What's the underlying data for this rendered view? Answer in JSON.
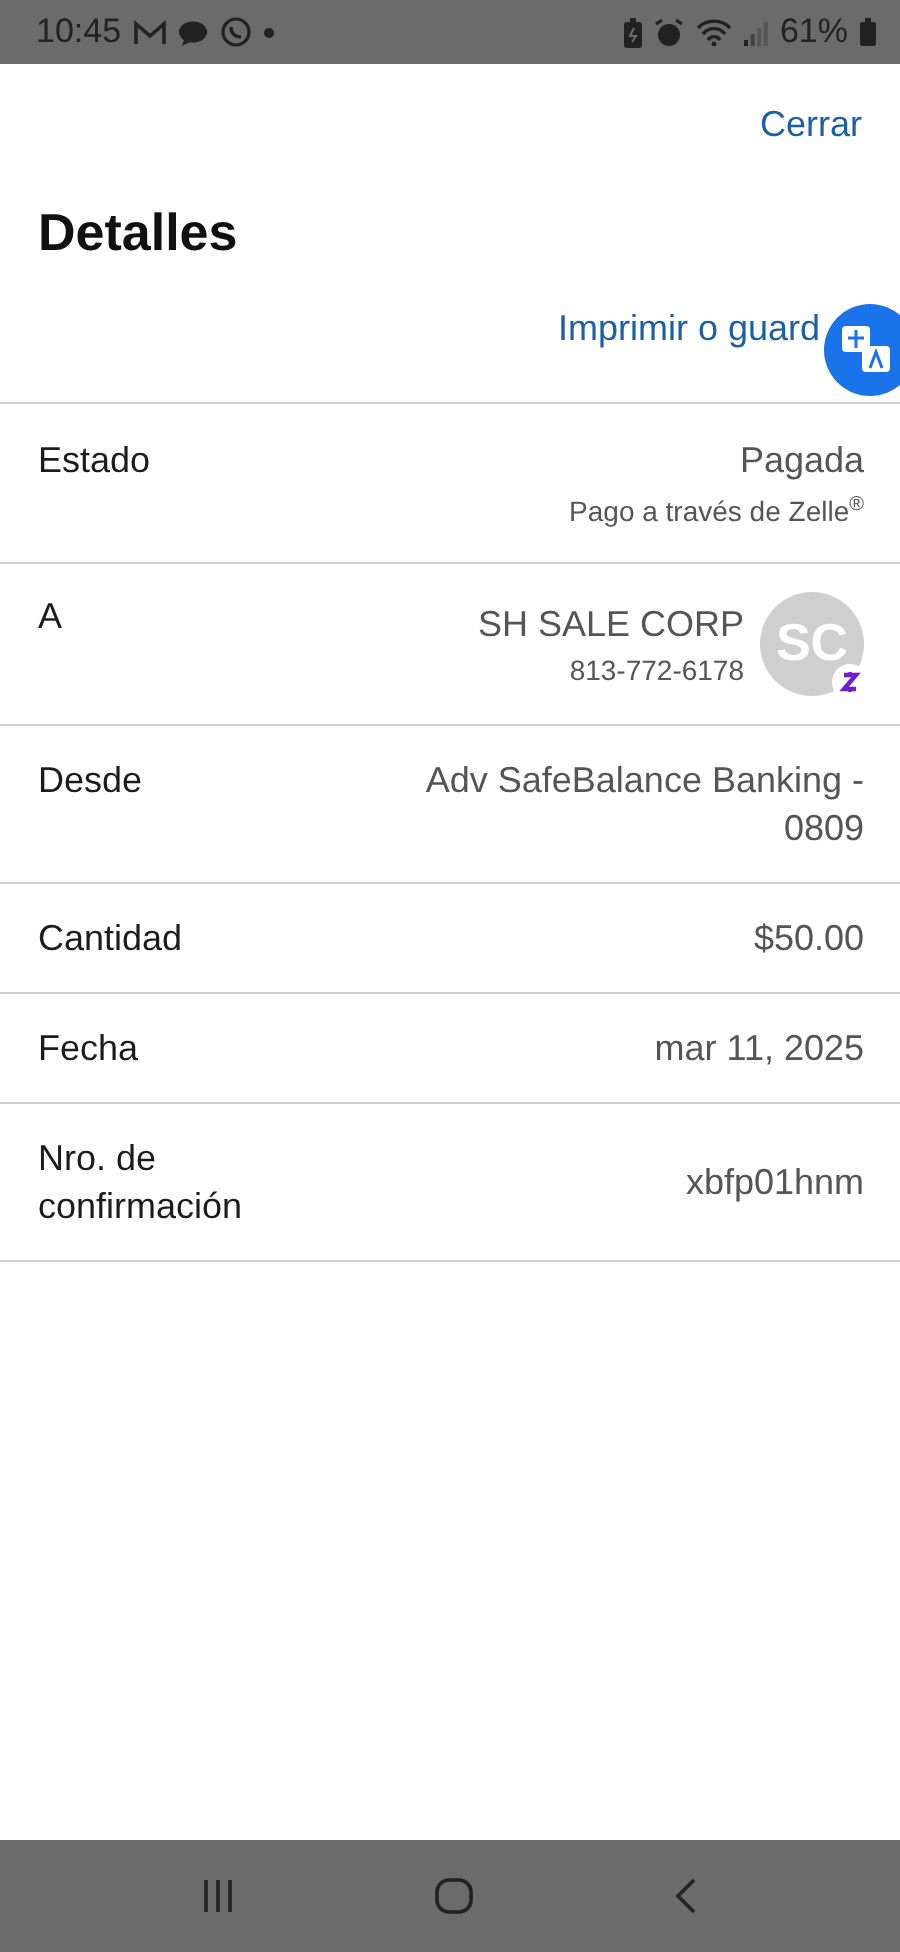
{
  "status_bar": {
    "time": "10:45",
    "battery": "61%"
  },
  "header": {
    "close": "Cerrar",
    "title": "Detalles",
    "print_link": "Imprimir o guard"
  },
  "rows": [
    {
      "kind": "status",
      "label": "Estado",
      "value": "Pagada",
      "note": "Pago a través de Zelle$^{®}$"
    },
    {
      "kind": "contact",
      "label": "A",
      "value": "SH SALE CORP",
      "note": "813-772-6178",
      "avatar": "SC"
    },
    {
      "kind": "plain",
      "label": "Desde",
      "value": "Adv SafeBalance Banking - 0809"
    },
    {
      "kind": "plain",
      "label": "Cantidad",
      "value": "$50.00"
    },
    {
      "kind": "plain",
      "label": "Fecha",
      "value": "mar 11, 2025"
    },
    {
      "kind": "plain",
      "label": "Nro. de confirmación",
      "value": "xbfp01hnm"
    }
  ]
}
